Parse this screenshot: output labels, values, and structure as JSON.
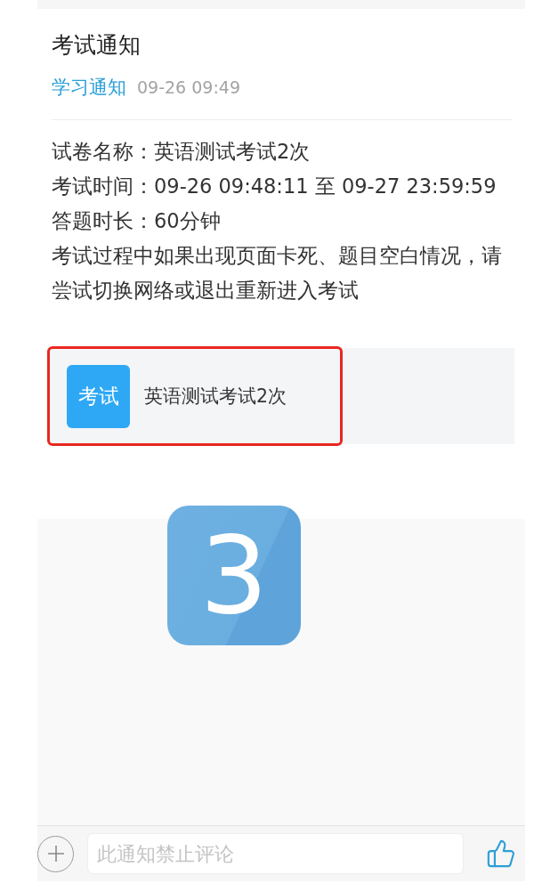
{
  "notice": {
    "title": "考试通知",
    "category": "学习通知",
    "time": "09-26 09:49"
  },
  "details": [
    "试卷名称：英语测试考试2次",
    "考试时间：09-26 09:48:11 至 09-27 23:59:59",
    "答题时长：60分钟",
    "考试过程中如果出现页面卡死、题目空白情况，请尝试切换网络或退出重新进入考试"
  ],
  "attachment": {
    "tag": "考试",
    "title": "英语测试考试2次",
    "highlighted": true
  },
  "step_badge": {
    "number": "3"
  },
  "comment_bar": {
    "placeholder": "此通知禁止评论"
  }
}
